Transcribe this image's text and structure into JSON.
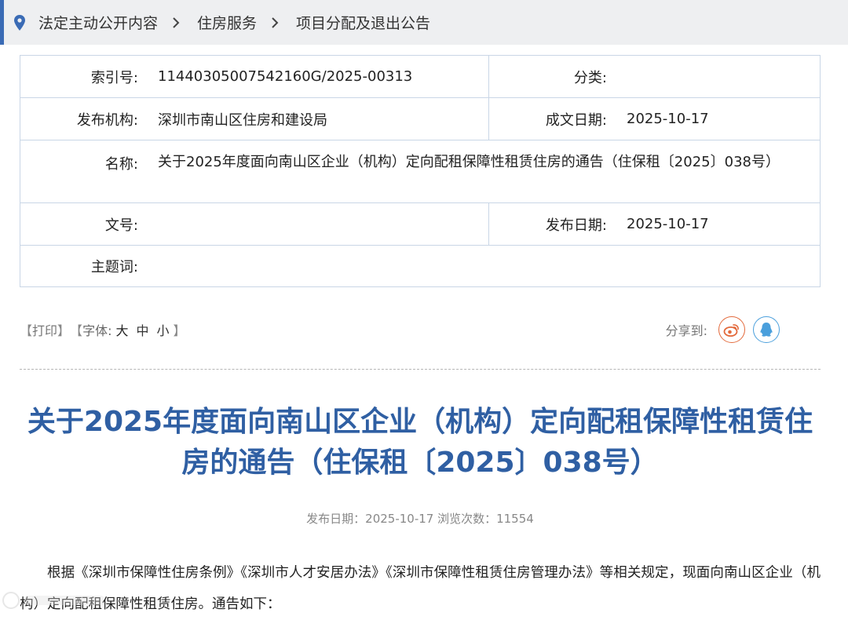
{
  "breadcrumb": {
    "items": [
      "法定主动公开内容",
      "住房服务",
      "项目分配及退出公告"
    ]
  },
  "meta": {
    "index_label": "索引号:",
    "index_value": "11440305007542160G/2025-00313",
    "category_label": "分类:",
    "category_value": "",
    "publisher_label": "发布机构:",
    "publisher_value": "深圳市南山区住房和建设局",
    "created_label": "成文日期:",
    "created_value": "2025-10-17",
    "name_label": "名称:",
    "name_value": "关于2025年度面向南山区企业（机构）定向配租保障性租赁住房的通告（住保租〔2025〕038号）",
    "docno_label": "文号:",
    "docno_value": "",
    "published_label": "发布日期:",
    "published_value": "2025-10-17",
    "keywords_label": "主题词:",
    "keywords_value": ""
  },
  "tools": {
    "bracket_open": "【",
    "bracket_close": "】",
    "print": "打印",
    "font_label": "字体:",
    "font_large": "大",
    "font_medium": "中",
    "font_small": "小",
    "share_label": "分享到:"
  },
  "article": {
    "title": "关于2025年度面向南山区企业（机构）定向配租保障性租赁住房的通告（住保租〔2025〕038号）",
    "meta_line": "发布日期：2025-10-17  浏览次数：11554",
    "body": "根据《深圳市保障性住房条例》《深圳市人才安居办法》《深圳市保障性租赁住房管理办法》等相关规定，现面向南山区企业（机构）定向配租保障性租赁住房。通告如下："
  },
  "colors": {
    "accent": "#3a6bb5",
    "title": "#2f5fa3",
    "weibo": "#e36a3c",
    "qq": "#4a9fdc",
    "table_border": "#c9d6e6"
  }
}
